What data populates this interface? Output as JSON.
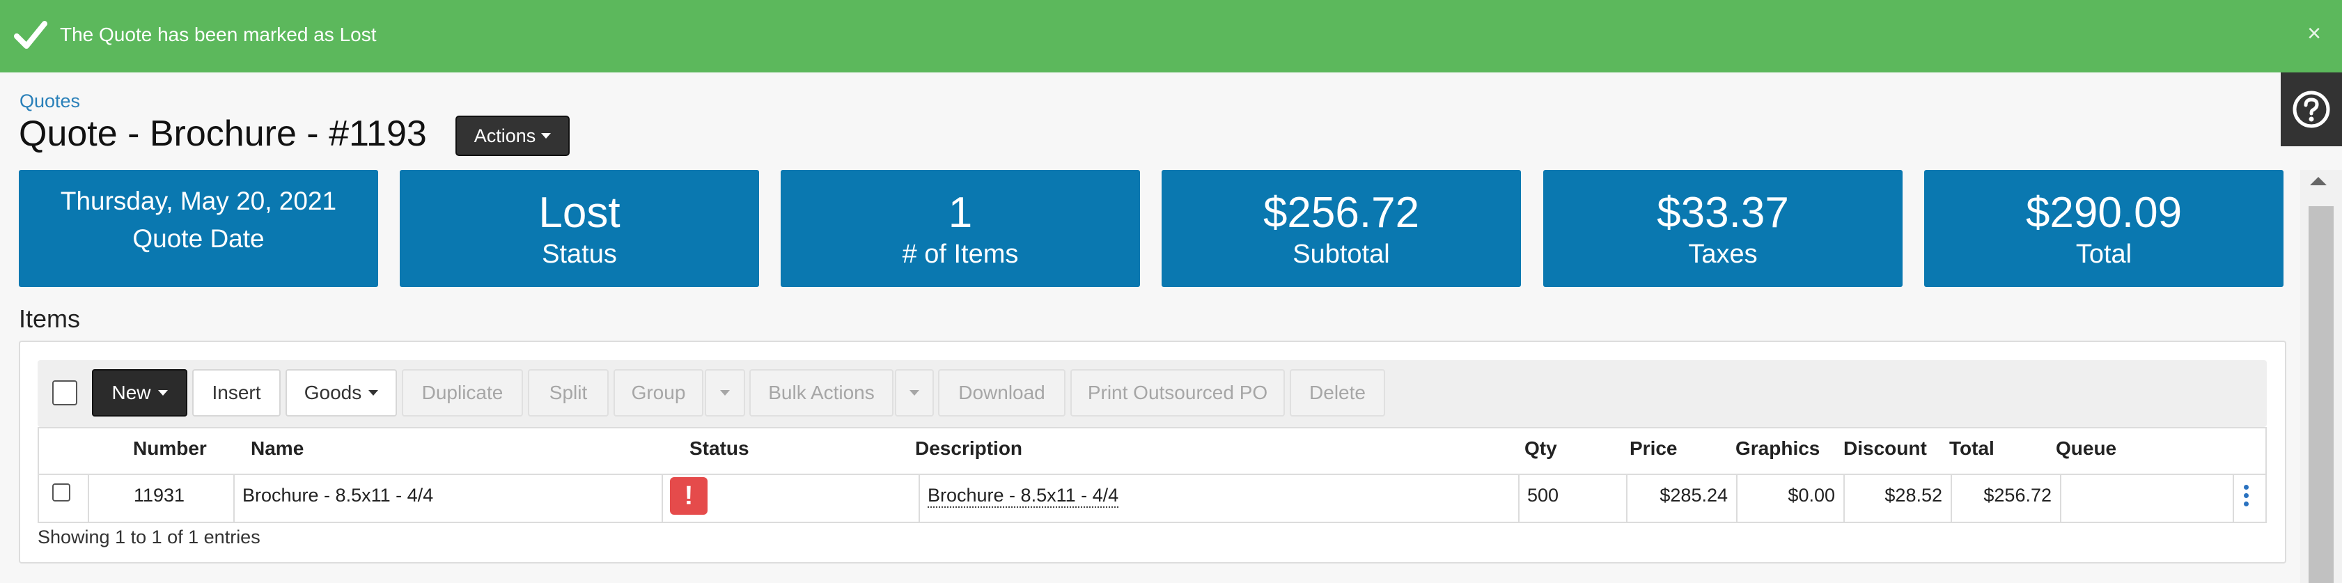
{
  "notification": {
    "message": "The Quote has been marked as Lost",
    "close_glyph": "×",
    "color": "#5cb85c"
  },
  "breadcrumb": "Quotes",
  "page_title": "Quote - Brochure - #1193",
  "actions_label": "Actions",
  "tiles": {
    "date": {
      "line1": "Thursday, May 20, 2021",
      "line2": "Quote Date"
    },
    "status": {
      "value": "Lost",
      "label": "Status"
    },
    "items": {
      "value": "1",
      "label": "# of Items"
    },
    "subtotal": {
      "value": "$256.72",
      "label": "Subtotal"
    },
    "taxes": {
      "value": "$33.37",
      "label": "Taxes"
    },
    "total": {
      "value": "$290.09",
      "label": "Total"
    },
    "color": "#0a78b0"
  },
  "items_section": {
    "title": "Items",
    "toolbar": {
      "new": "New",
      "insert": "Insert",
      "goods": "Goods",
      "duplicate": "Duplicate",
      "split": "Split",
      "group": "Group",
      "bulk_actions": "Bulk Actions",
      "download": "Download",
      "print_po": "Print Outsourced PO",
      "delete": "Delete"
    },
    "columns": {
      "number": "Number",
      "name": "Name",
      "status": "Status",
      "description": "Description",
      "qty": "Qty",
      "price": "Price",
      "graphics": "Graphics",
      "discount": "Discount",
      "total": "Total",
      "queue": "Queue"
    },
    "rows": [
      {
        "number": "11931",
        "name": "Brochure - 8.5x11 - 4/4",
        "status_icon": "!",
        "description": "Brochure - 8.5x11 - 4/4",
        "qty": "500",
        "price": "$285.24",
        "graphics": "$0.00",
        "discount": "$28.52",
        "total": "$256.72",
        "queue": ""
      }
    ],
    "footer": "Showing 1 to 1 of 1 entries"
  },
  "icons": [
    "check-icon",
    "close-icon",
    "help-icon",
    "caret-down-icon",
    "kebab-menu-icon",
    "alert-icon"
  ]
}
